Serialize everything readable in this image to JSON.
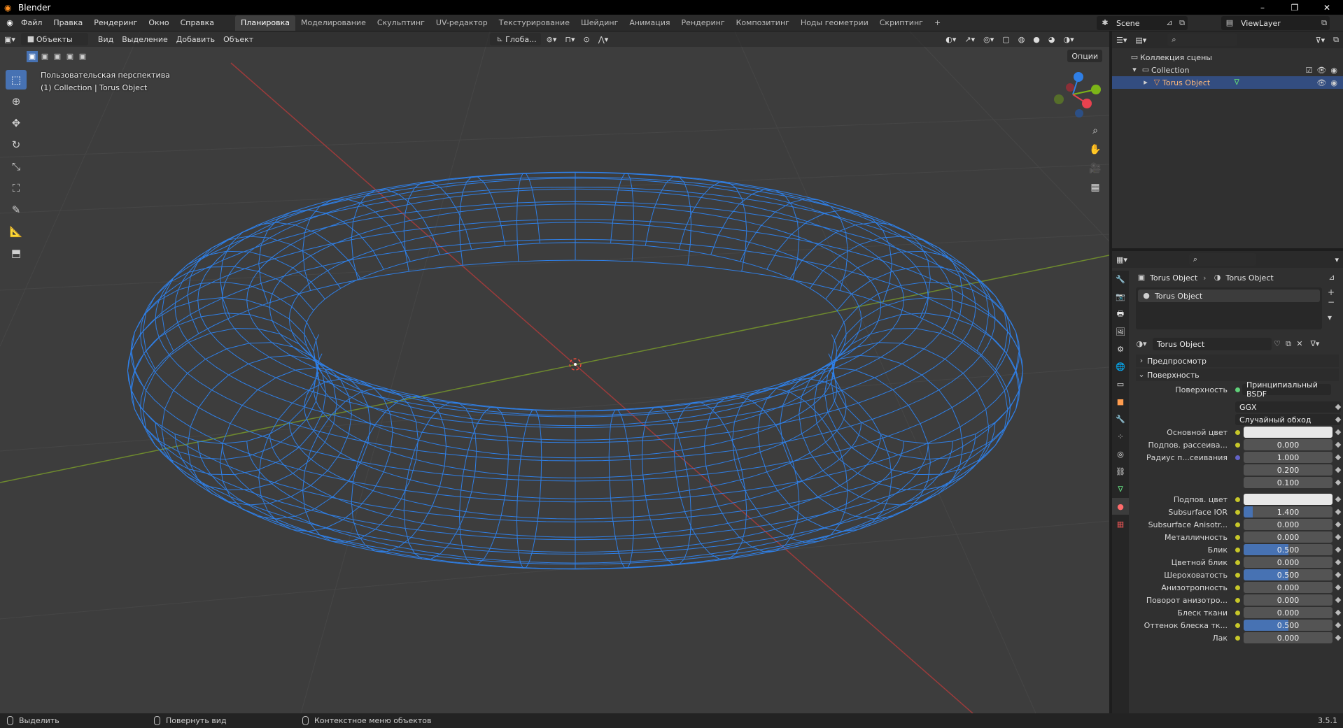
{
  "window": {
    "title": "Blender",
    "minimize": "–",
    "restore": "❐",
    "close": "✕"
  },
  "menu": [
    "Файл",
    "Правка",
    "Рендеринг",
    "Окно",
    "Справка"
  ],
  "workspaces": [
    "Планировка",
    "Моделирование",
    "Скульптинг",
    "UV-редактор",
    "Текстурирование",
    "Шейдинг",
    "Анимация",
    "Рендеринг",
    "Композитинг",
    "Ноды геометрии",
    "Скриптинг",
    "+"
  ],
  "active_workspace": "Планировка",
  "scene": {
    "label": "Scene",
    "view_layer": "ViewLayer"
  },
  "viewport": {
    "mode": "Объекты",
    "menus": [
      "Вид",
      "Выделение",
      "Добавить",
      "Объект"
    ],
    "transform_orientation": "Глоба...",
    "options": "Опции",
    "perspective": "Пользовательская перспектива",
    "collection_info": "(1) Collection | Torus Object"
  },
  "outliner": {
    "scene_collection": "Коллекция сцены",
    "collection": "Collection",
    "object": "Torus Object"
  },
  "properties": {
    "breadcrumb_object": "Torus Object",
    "breadcrumb_material": "Torus Object",
    "material_slot": "Torus Object",
    "material_name": "Torus Object",
    "sections": {
      "preview": "Предпросмотр",
      "surface": "Поверхность"
    },
    "surface_label": "Поверхность",
    "surface_shader": "Принципиальный BSDF",
    "distribution": "GGX",
    "subsurface_method": "Случайный обход",
    "rows": [
      {
        "label": "Основной цвет",
        "value": "",
        "color": "#e8e8e8"
      },
      {
        "label": "Подпов. рассеива...",
        "value": "0.000",
        "fill": 0
      },
      {
        "label": "Радиус п...сеивания",
        "value": "1.000",
        "fill": 0
      },
      {
        "label": "",
        "value": "0.200",
        "fill": 0
      },
      {
        "label": "",
        "value": "0.100",
        "fill": 0
      },
      {
        "label": "Подпов. цвет",
        "value": "",
        "color": "#e8e8e8"
      },
      {
        "label": "Subsurface IOR",
        "value": "1.400",
        "fill": 0.1
      },
      {
        "label": "Subsurface Anisotr...",
        "value": "0.000",
        "fill": 0
      },
      {
        "label": "Металличность",
        "value": "0.000",
        "fill": 0
      },
      {
        "label": "Блик",
        "value": "0.500",
        "fill": 0.5
      },
      {
        "label": "Цветной блик",
        "value": "0.000",
        "fill": 0
      },
      {
        "label": "Шероховатость",
        "value": "0.500",
        "fill": 0.5
      },
      {
        "label": "Анизотропность",
        "value": "0.000",
        "fill": 0
      },
      {
        "label": "Поворот анизотро...",
        "value": "0.000",
        "fill": 0
      },
      {
        "label": "Блеск ткани",
        "value": "0.000",
        "fill": 0
      },
      {
        "label": "Оттенок блеска тк...",
        "value": "0.500",
        "fill": 0.5
      },
      {
        "label": "Лак",
        "value": "0.000",
        "fill": 0
      }
    ]
  },
  "statusbar": {
    "select": "Выделить",
    "rotate": "Повернуть вид",
    "context": "Контекстное меню объектов",
    "version": "3.5.1"
  },
  "colors": {
    "accent": "#4772b3",
    "wire": "#2f7fe6",
    "viewport_bg": "#3d3d3d"
  }
}
